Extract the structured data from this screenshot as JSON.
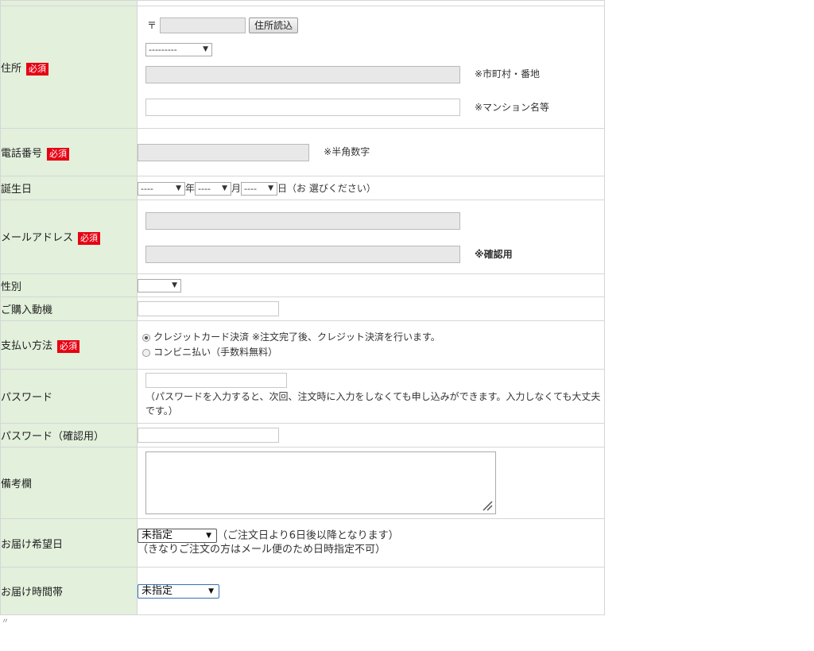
{
  "rows": {
    "address": {
      "label": "住所",
      "required": "必須",
      "postal_mark": "〒",
      "postal_value": "",
      "lookup_button": "住所読込",
      "prefecture_select": "---------",
      "city_note": "※市町村・番地",
      "building_note": "※マンション名等"
    },
    "phone": {
      "label": "電話番号",
      "required": "必須",
      "note": "※半角数字"
    },
    "birthday": {
      "label": "誕生日",
      "year_select": "----",
      "year_label": "年",
      "month_select": "----",
      "month_label": "月",
      "day_select": "----",
      "day_label": "日",
      "hint": "（お 選びください）"
    },
    "email": {
      "label": "メールアドレス",
      "required": "必須",
      "confirm_note": "※確認用"
    },
    "gender": {
      "label": "性別",
      "select": ""
    },
    "motive": {
      "label": "ご購入動機"
    },
    "payment": {
      "label": "支払い方法",
      "required": "必須",
      "options": [
        {
          "label": "クレジットカード決済 ※注文完了後、クレジット決済を行います。",
          "checked": true
        },
        {
          "label": "コンビニ払い（手数料無料）",
          "checked": false
        }
      ]
    },
    "password": {
      "label": "パスワード",
      "hint": "（パスワードを入力すると、次回、注文時に入力をしなくても申し込みができます。入力しなくても大丈夫です。）"
    },
    "password_confirm": {
      "label": "パスワード（確認用）"
    },
    "remarks": {
      "label": "備考欄"
    },
    "delivery_date": {
      "label": "お届け希望日",
      "select": "未指定",
      "note1": "（ご注文日より6日後以降となります）",
      "note2": "（きなりご注文の方はメール便のため日時指定不可）"
    },
    "delivery_time": {
      "label": "お届け時間帯",
      "select": "未指定"
    }
  },
  "footer_mark": "〃"
}
